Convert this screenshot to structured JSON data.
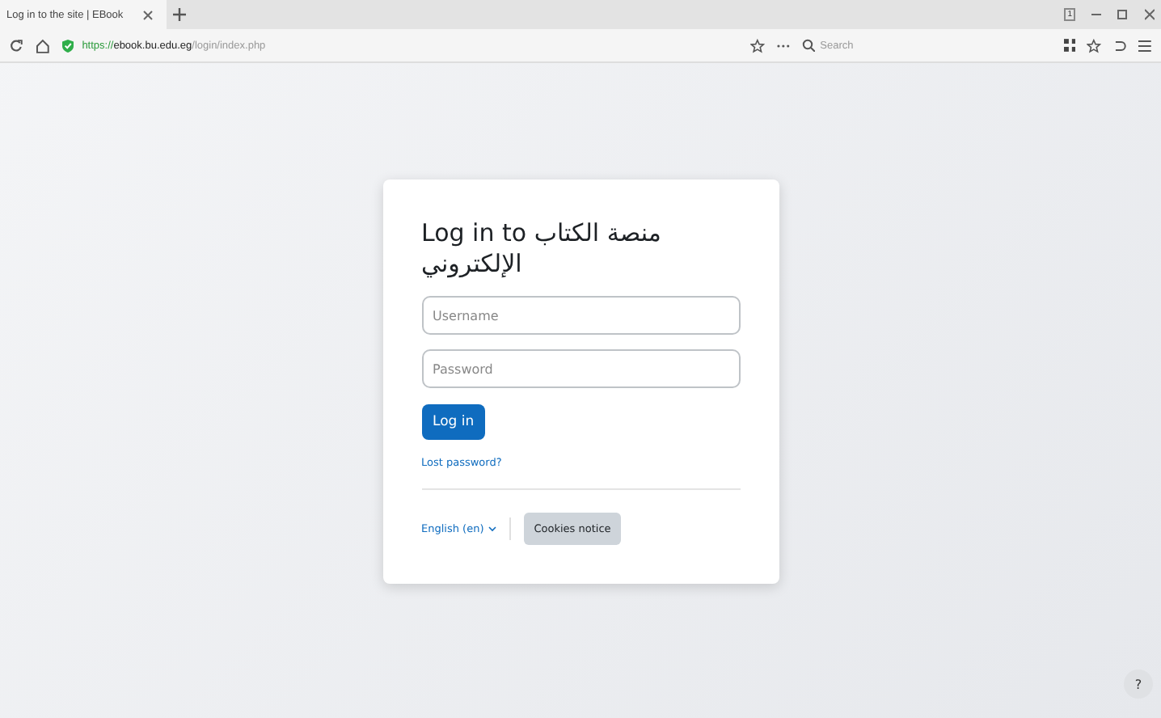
{
  "browser": {
    "tab": {
      "title": "Log in to the site | EBook",
      "selected": true
    },
    "url": {
      "scheme": "https://",
      "host": "ebook.bu.edu.eg",
      "path": "/login/index.php"
    },
    "search": {
      "placeholder": "Search"
    },
    "tab_count": "1"
  },
  "login": {
    "title": "Log in to منصة الكتاب الإلكتروني",
    "username": {
      "placeholder": "Username"
    },
    "password": {
      "placeholder": "Password"
    },
    "submit": "Log in",
    "lost_password": "Lost password?",
    "language": "English (en)",
    "cookies": "Cookies notice"
  },
  "help": "?"
}
